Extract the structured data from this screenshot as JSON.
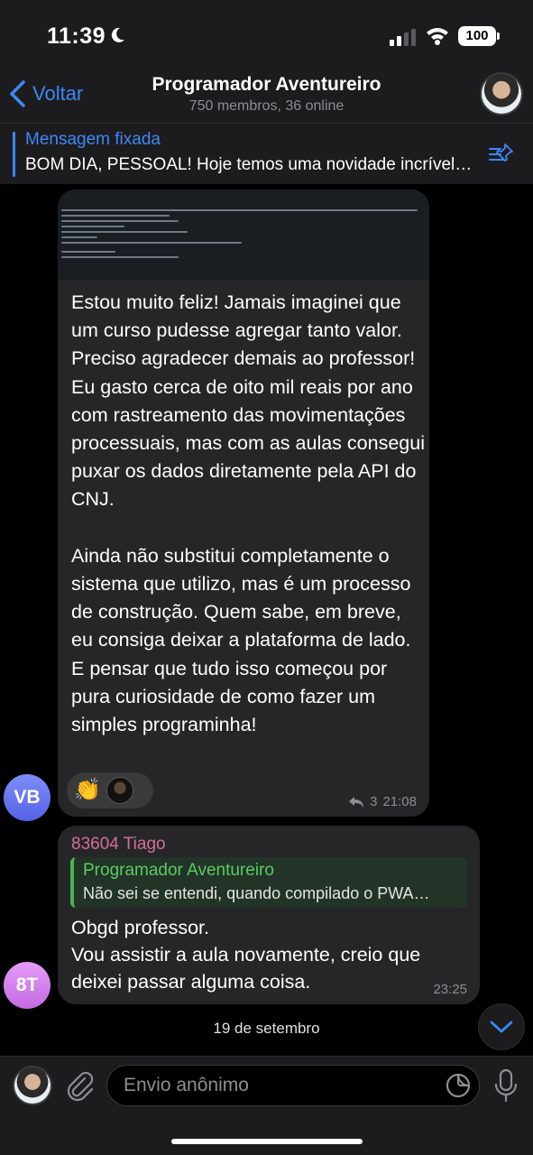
{
  "status_bar": {
    "time": "11:39",
    "battery": "100"
  },
  "header": {
    "back_label": "Voltar",
    "title": "Programador Aventureiro",
    "subtitle": "750 membros, 36 online"
  },
  "pinned": {
    "label": "Mensagem fixada",
    "text": "BOM DIA, PESSOAL! Hoje temos uma novidade incrível…"
  },
  "messages": [
    {
      "avatar_initials": "VB",
      "text": "Estou muito feliz! Jamais imaginei que um curso pudesse agregar tanto valor. Preciso agradecer demais ao professor! Eu gasto cerca de oito mil reais por ano com rastreamento das movimentações processuais, mas com as aulas consegui puxar os dados diretamente pela API do CNJ.\n\nAinda não substitui completamente o sistema que utilizo, mas é um processo de construção. Quem sabe, em breve, eu consiga deixar a plataforma de lado. E pensar que tudo isso começou por pura curiosidade de como fazer um simples programinha!",
      "reaction_emoji": "👏",
      "replies": "3",
      "time": "21:08"
    },
    {
      "avatar_initials": "8T",
      "sender": "83604 Tiago",
      "quote_title": "Programador Aventureiro",
      "quote_text": "Não sei se entendi, quando compilado o PWA…",
      "text": "Obgd professor.\nVou assistir a aula novamente, creio que deixei passar alguma coisa.",
      "time": "23:25"
    }
  ],
  "date_separator": "19 de setembro",
  "input": {
    "placeholder": "Envio anônimo"
  },
  "colors": {
    "accent": "#3e88f7",
    "bubble": "#262628",
    "sender": "#d36e97",
    "quote": "#5ccb5f"
  }
}
